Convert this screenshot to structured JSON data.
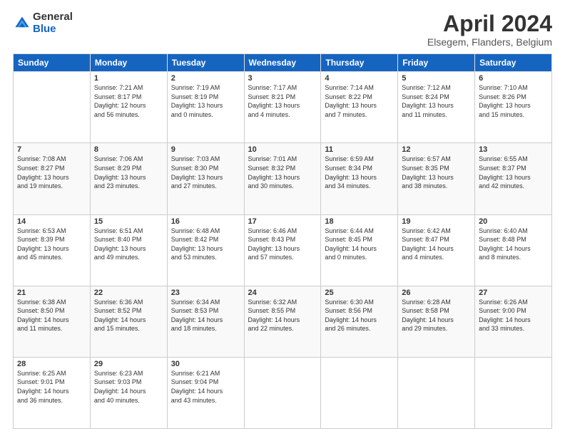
{
  "header": {
    "logo_general": "General",
    "logo_blue": "Blue",
    "month_title": "April 2024",
    "location": "Elsegem, Flanders, Belgium"
  },
  "weekdays": [
    "Sunday",
    "Monday",
    "Tuesday",
    "Wednesday",
    "Thursday",
    "Friday",
    "Saturday"
  ],
  "weeks": [
    [
      {
        "day": "",
        "info": ""
      },
      {
        "day": "1",
        "info": "Sunrise: 7:21 AM\nSunset: 8:17 PM\nDaylight: 12 hours\nand 56 minutes."
      },
      {
        "day": "2",
        "info": "Sunrise: 7:19 AM\nSunset: 8:19 PM\nDaylight: 13 hours\nand 0 minutes."
      },
      {
        "day": "3",
        "info": "Sunrise: 7:17 AM\nSunset: 8:21 PM\nDaylight: 13 hours\nand 4 minutes."
      },
      {
        "day": "4",
        "info": "Sunrise: 7:14 AM\nSunset: 8:22 PM\nDaylight: 13 hours\nand 7 minutes."
      },
      {
        "day": "5",
        "info": "Sunrise: 7:12 AM\nSunset: 8:24 PM\nDaylight: 13 hours\nand 11 minutes."
      },
      {
        "day": "6",
        "info": "Sunrise: 7:10 AM\nSunset: 8:26 PM\nDaylight: 13 hours\nand 15 minutes."
      }
    ],
    [
      {
        "day": "7",
        "info": "Sunrise: 7:08 AM\nSunset: 8:27 PM\nDaylight: 13 hours\nand 19 minutes."
      },
      {
        "day": "8",
        "info": "Sunrise: 7:06 AM\nSunset: 8:29 PM\nDaylight: 13 hours\nand 23 minutes."
      },
      {
        "day": "9",
        "info": "Sunrise: 7:03 AM\nSunset: 8:30 PM\nDaylight: 13 hours\nand 27 minutes."
      },
      {
        "day": "10",
        "info": "Sunrise: 7:01 AM\nSunset: 8:32 PM\nDaylight: 13 hours\nand 30 minutes."
      },
      {
        "day": "11",
        "info": "Sunrise: 6:59 AM\nSunset: 8:34 PM\nDaylight: 13 hours\nand 34 minutes."
      },
      {
        "day": "12",
        "info": "Sunrise: 6:57 AM\nSunset: 8:35 PM\nDaylight: 13 hours\nand 38 minutes."
      },
      {
        "day": "13",
        "info": "Sunrise: 6:55 AM\nSunset: 8:37 PM\nDaylight: 13 hours\nand 42 minutes."
      }
    ],
    [
      {
        "day": "14",
        "info": "Sunrise: 6:53 AM\nSunset: 8:39 PM\nDaylight: 13 hours\nand 45 minutes."
      },
      {
        "day": "15",
        "info": "Sunrise: 6:51 AM\nSunset: 8:40 PM\nDaylight: 13 hours\nand 49 minutes."
      },
      {
        "day": "16",
        "info": "Sunrise: 6:48 AM\nSunset: 8:42 PM\nDaylight: 13 hours\nand 53 minutes."
      },
      {
        "day": "17",
        "info": "Sunrise: 6:46 AM\nSunset: 8:43 PM\nDaylight: 13 hours\nand 57 minutes."
      },
      {
        "day": "18",
        "info": "Sunrise: 6:44 AM\nSunset: 8:45 PM\nDaylight: 14 hours\nand 0 minutes."
      },
      {
        "day": "19",
        "info": "Sunrise: 6:42 AM\nSunset: 8:47 PM\nDaylight: 14 hours\nand 4 minutes."
      },
      {
        "day": "20",
        "info": "Sunrise: 6:40 AM\nSunset: 8:48 PM\nDaylight: 14 hours\nand 8 minutes."
      }
    ],
    [
      {
        "day": "21",
        "info": "Sunrise: 6:38 AM\nSunset: 8:50 PM\nDaylight: 14 hours\nand 11 minutes."
      },
      {
        "day": "22",
        "info": "Sunrise: 6:36 AM\nSunset: 8:52 PM\nDaylight: 14 hours\nand 15 minutes."
      },
      {
        "day": "23",
        "info": "Sunrise: 6:34 AM\nSunset: 8:53 PM\nDaylight: 14 hours\nand 18 minutes."
      },
      {
        "day": "24",
        "info": "Sunrise: 6:32 AM\nSunset: 8:55 PM\nDaylight: 14 hours\nand 22 minutes."
      },
      {
        "day": "25",
        "info": "Sunrise: 6:30 AM\nSunset: 8:56 PM\nDaylight: 14 hours\nand 26 minutes."
      },
      {
        "day": "26",
        "info": "Sunrise: 6:28 AM\nSunset: 8:58 PM\nDaylight: 14 hours\nand 29 minutes."
      },
      {
        "day": "27",
        "info": "Sunrise: 6:26 AM\nSunset: 9:00 PM\nDaylight: 14 hours\nand 33 minutes."
      }
    ],
    [
      {
        "day": "28",
        "info": "Sunrise: 6:25 AM\nSunset: 9:01 PM\nDaylight: 14 hours\nand 36 minutes."
      },
      {
        "day": "29",
        "info": "Sunrise: 6:23 AM\nSunset: 9:03 PM\nDaylight: 14 hours\nand 40 minutes."
      },
      {
        "day": "30",
        "info": "Sunrise: 6:21 AM\nSunset: 9:04 PM\nDaylight: 14 hours\nand 43 minutes."
      },
      {
        "day": "",
        "info": ""
      },
      {
        "day": "",
        "info": ""
      },
      {
        "day": "",
        "info": ""
      },
      {
        "day": "",
        "info": ""
      }
    ]
  ]
}
